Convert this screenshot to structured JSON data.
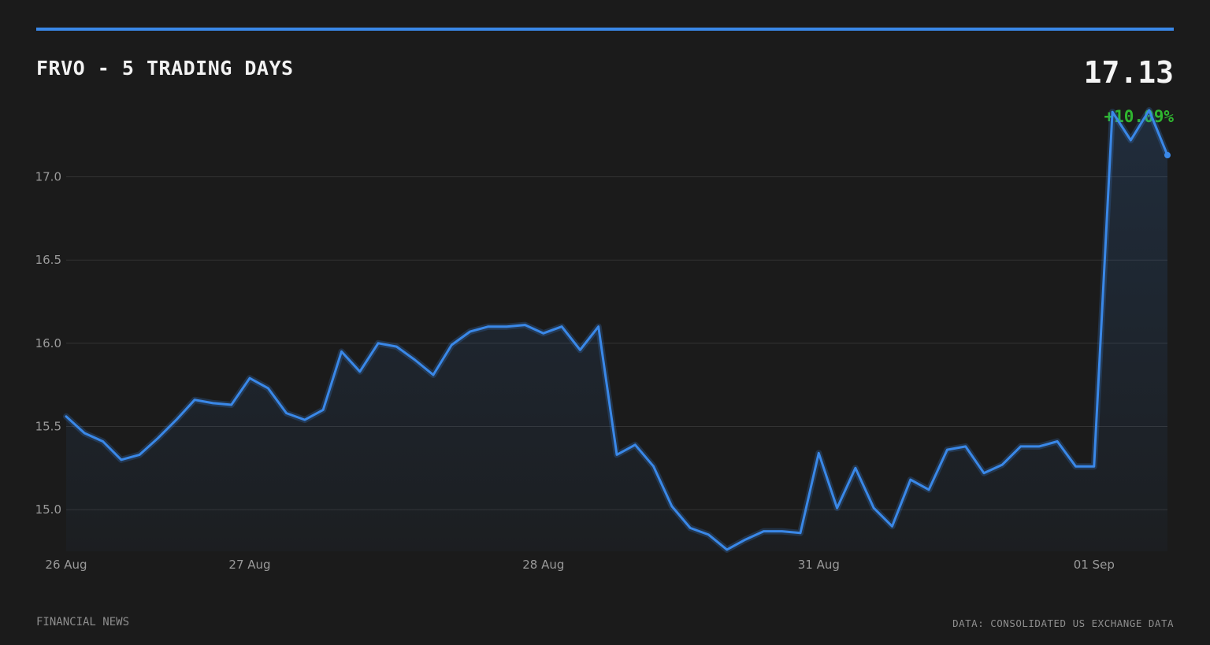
{
  "header": {
    "title": "FRVO - 5 TRADING DAYS",
    "price": "17.13",
    "change": "+10.09%"
  },
  "footer": {
    "source_left": "FINANCIAL NEWS",
    "source_right": "DATA: CONSOLIDATED US EXCHANGE DATA"
  },
  "colors": {
    "line": "#3a88e8",
    "positive": "#2fb62f",
    "background": "#1b1b1b",
    "grid": "#333333"
  },
  "chart_data": {
    "type": "area",
    "title": "FRVO - 5 TRADING DAYS",
    "xlabel": "",
    "ylabel": "",
    "ylim": [
      14.75,
      17.4
    ],
    "grid": true,
    "yticks": [
      15.0,
      15.5,
      16.0,
      16.5,
      17.0
    ],
    "ytick_labels": [
      "15.0",
      "15.5",
      "16.0",
      "16.5",
      "17.0"
    ],
    "xticks": [
      {
        "label": "26 Aug",
        "index": 0
      },
      {
        "label": "27 Aug",
        "index": 10
      },
      {
        "label": "28 Aug",
        "index": 26
      },
      {
        "label": "31 Aug",
        "index": 41
      },
      {
        "label": "01 Sep",
        "index": 56
      }
    ],
    "series": [
      {
        "values": [
          15.56,
          15.46,
          15.41,
          15.3,
          15.33,
          15.43,
          15.54,
          15.66,
          15.64,
          15.63,
          15.79,
          15.73,
          15.58,
          15.54,
          15.6,
          15.95,
          15.83,
          16.0,
          15.98,
          15.9,
          15.81,
          15.99,
          16.07,
          16.1,
          16.1,
          16.11,
          16.06,
          16.1,
          15.96,
          16.1,
          15.33,
          15.39,
          15.26,
          15.02,
          14.89,
          14.85,
          14.76,
          14.82,
          14.87,
          14.87,
          14.86,
          15.34,
          15.01,
          15.25,
          15.01,
          14.9,
          15.18,
          15.12,
          15.36,
          15.38,
          15.22,
          15.27,
          15.38,
          15.38,
          15.41,
          15.26,
          15.26,
          17.39,
          17.22,
          17.4,
          17.13
        ]
      }
    ]
  }
}
